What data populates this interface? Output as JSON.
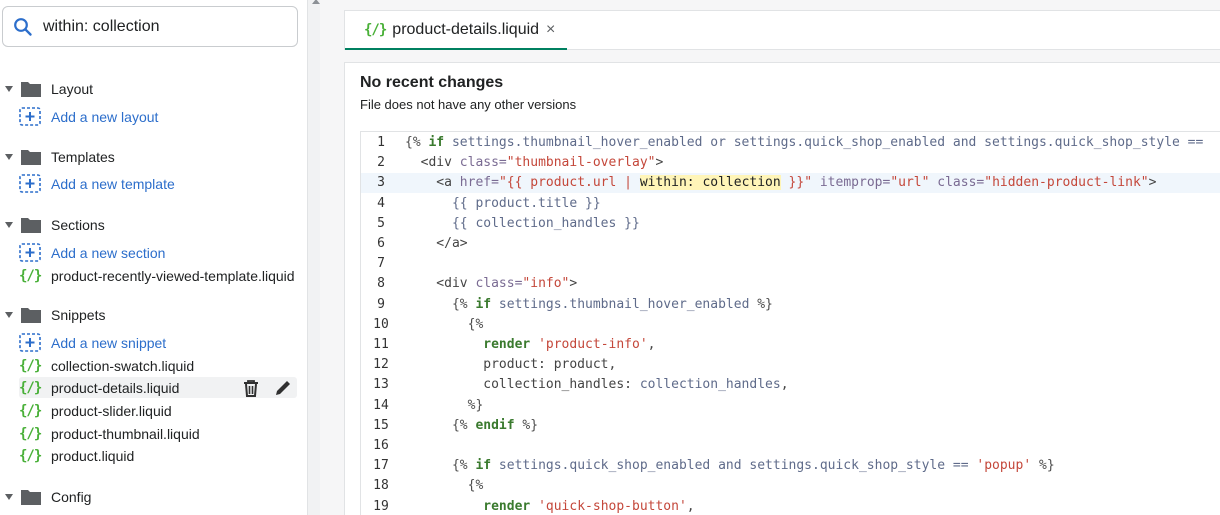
{
  "search": {
    "value": "within: collection"
  },
  "sidebar": {
    "folders": [
      {
        "label": "Layout"
      },
      {
        "label": "Templates"
      },
      {
        "label": "Sections"
      },
      {
        "label": "Snippets"
      },
      {
        "label": "Config"
      }
    ],
    "add_links": {
      "layout": "Add a new layout",
      "template": "Add a new template",
      "section": "Add a new section",
      "snippet": "Add a new snippet"
    },
    "section_files": [
      "product-recently-viewed-template.liquid"
    ],
    "snippet_files": [
      "collection-swatch.liquid",
      "product-details.liquid",
      "product-slider.liquid",
      "product-thumbnail.liquid",
      "product.liquid"
    ],
    "liquid_icon": "{/}"
  },
  "editor": {
    "tab": {
      "label": "product-details.liquid",
      "close": "×"
    },
    "title": "No recent changes",
    "subtitle": "File does not have any other versions"
  },
  "code": {
    "active_line": 3,
    "lines": [
      [
        [
          "c-tag",
          "{%"
        ],
        [
          "c-plain",
          " "
        ],
        [
          "c-kw",
          "if"
        ],
        [
          "c-var",
          " settings.thumbnail_hover_enabled or settings.quick_shop_enabled and settings.quick_shop_style == "
        ]
      ],
      [
        [
          "c-plain",
          "  <div "
        ],
        [
          "c-attr",
          "class="
        ],
        [
          "c-str",
          "\"thumbnail-overlay\""
        ],
        [
          "c-plain",
          ">"
        ]
      ],
      [
        [
          "c-plain",
          "    <a "
        ],
        [
          "c-attr",
          "href="
        ],
        [
          "c-str",
          "\"{{ product.url | "
        ],
        [
          "c-hl",
          "within: collection"
        ],
        [
          "c-str",
          " }}\""
        ],
        [
          "c-plain",
          " "
        ],
        [
          "c-attr",
          "itemprop="
        ],
        [
          "c-str",
          "\"url\""
        ],
        [
          "c-plain",
          " "
        ],
        [
          "c-attr",
          "class="
        ],
        [
          "c-str",
          "\"hidden-product-link\""
        ],
        [
          "c-plain",
          ">"
        ]
      ],
      [
        [
          "c-var",
          "      {{ product.title }}"
        ]
      ],
      [
        [
          "c-var",
          "      {{ collection_handles }}"
        ]
      ],
      [
        [
          "c-plain",
          "    </a>"
        ]
      ],
      [
        [
          "c-plain",
          ""
        ]
      ],
      [
        [
          "c-plain",
          "    <div "
        ],
        [
          "c-attr",
          "class="
        ],
        [
          "c-str",
          "\"info\""
        ],
        [
          "c-plain",
          ">"
        ]
      ],
      [
        [
          "c-tag",
          "      {%"
        ],
        [
          "c-plain",
          " "
        ],
        [
          "c-kw",
          "if"
        ],
        [
          "c-var",
          " settings.thumbnail_hover_enabled "
        ],
        [
          "c-tag",
          "%}"
        ]
      ],
      [
        [
          "c-tag",
          "        {%"
        ]
      ],
      [
        [
          "c-plain",
          "          "
        ],
        [
          "c-kw",
          "render"
        ],
        [
          "c-plain",
          " "
        ],
        [
          "c-str",
          "'product-info'"
        ],
        [
          "c-plain",
          ","
        ]
      ],
      [
        [
          "c-plain",
          "          product: product,"
        ]
      ],
      [
        [
          "c-plain",
          "          collection_handles: "
        ],
        [
          "c-var",
          "collection_handles"
        ],
        [
          "c-plain",
          ","
        ]
      ],
      [
        [
          "c-tag",
          "        %}"
        ]
      ],
      [
        [
          "c-tag",
          "      {%"
        ],
        [
          "c-plain",
          " "
        ],
        [
          "c-kw",
          "endif"
        ],
        [
          "c-plain",
          " "
        ],
        [
          "c-tag",
          "%}"
        ]
      ],
      [
        [
          "c-plain",
          ""
        ]
      ],
      [
        [
          "c-tag",
          "      {%"
        ],
        [
          "c-plain",
          " "
        ],
        [
          "c-kw",
          "if"
        ],
        [
          "c-var",
          " settings.quick_shop_enabled and settings.quick_shop_style == "
        ],
        [
          "c-str",
          "'popup'"
        ],
        [
          "c-plain",
          " "
        ],
        [
          "c-tag",
          "%}"
        ]
      ],
      [
        [
          "c-tag",
          "        {%"
        ]
      ],
      [
        [
          "c-plain",
          "          "
        ],
        [
          "c-kw",
          "render"
        ],
        [
          "c-plain",
          " "
        ],
        [
          "c-str",
          "'quick-shop-button'"
        ],
        [
          "c-plain",
          ","
        ]
      ]
    ]
  },
  "colors": {
    "accent": "#008060",
    "link": "#2c6ecb",
    "liquid": "#49b038",
    "highlight": "#fff5b8"
  }
}
